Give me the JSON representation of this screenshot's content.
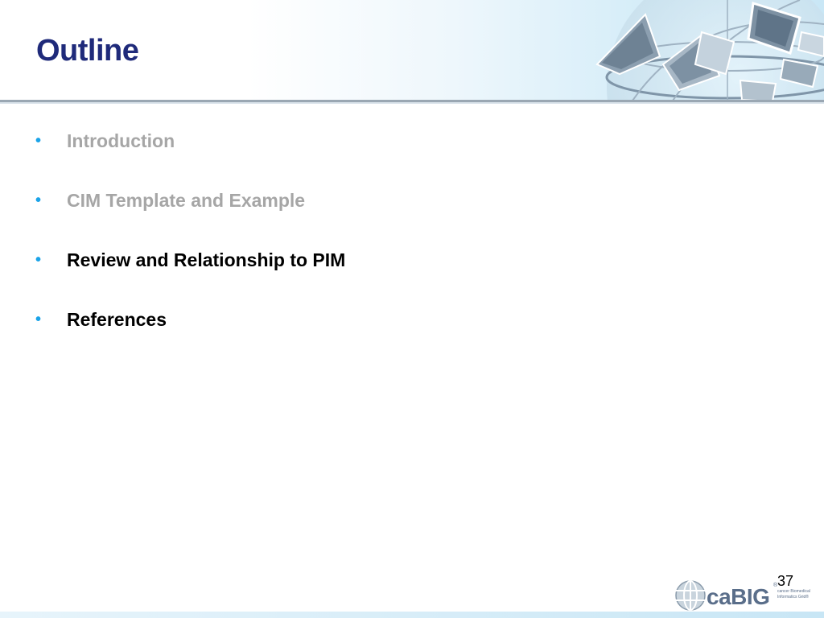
{
  "slide": {
    "title": "Outline",
    "bullets": [
      {
        "label": "Introduction",
        "state": "dimmed"
      },
      {
        "label": "CIM Template and Example",
        "state": "dimmed"
      },
      {
        "label": "Review and Relationship to PIM",
        "state": "active"
      },
      {
        "label": "References",
        "state": "active"
      }
    ],
    "page_number": "37",
    "bullet_symbol": "•"
  },
  "logo": {
    "wordmark": "caBIG",
    "registered": "®",
    "tagline_line1": "cancer Biomedical",
    "tagline_line2": "Informatics Grid®"
  },
  "colors": {
    "title": "#1f2a7a",
    "bullet": "#1aa3e8",
    "dimmed_text": "#a6a6a6",
    "active_text": "#000000"
  },
  "icons": {
    "header_graphic": "globe-collage-icon",
    "logo_mark": "globe-logo-icon"
  }
}
